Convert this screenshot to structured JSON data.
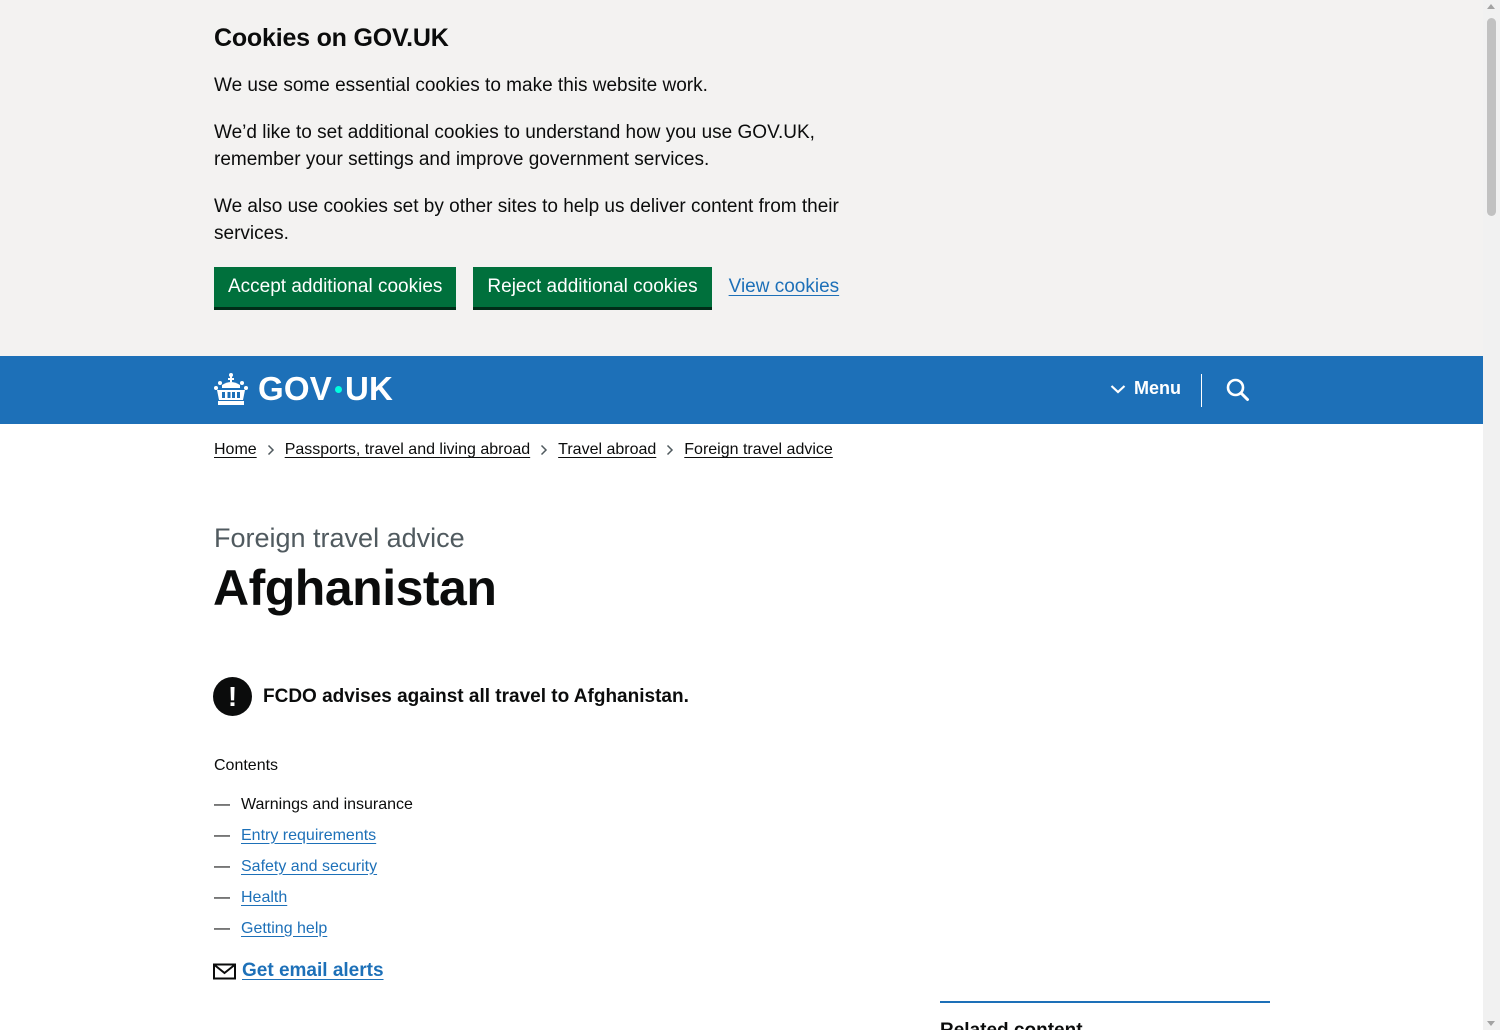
{
  "cookie_banner": {
    "title": "Cookies on GOV.UK",
    "paragraphs": [
      "We use some essential cookies to make this website work.",
      "We’d like to set additional cookies to understand how you use GOV.UK, remember your settings and improve government services.",
      "We also use cookies set by other sites to help us deliver content from their services."
    ],
    "accept_label": "Accept additional cookies",
    "reject_label": "Reject additional cookies",
    "view_label": "View cookies"
  },
  "header": {
    "logo_left": "GOV",
    "logo_right": "UK",
    "menu_label": "Menu",
    "icons": {
      "crown": "crown-icon",
      "menu": "chevron-down-icon",
      "search": "search-icon"
    },
    "colors": {
      "background": "#1d70b8",
      "logo_dot": "#00ffe0"
    }
  },
  "breadcrumbs": [
    "Home",
    "Passports, travel and living abroad",
    "Travel abroad",
    "Foreign travel advice"
  ],
  "page": {
    "caption": "Foreign travel advice",
    "title": "Afghanistan",
    "warning_text": "FCDO advises against all travel to Afghanistan.",
    "warning_icon_glyph": "!"
  },
  "contents": {
    "label": "Contents",
    "items": [
      {
        "label": "Warnings and insurance",
        "current": true
      },
      {
        "label": "Entry requirements",
        "current": false
      },
      {
        "label": "Safety and security",
        "current": false
      },
      {
        "label": "Health",
        "current": false
      },
      {
        "label": "Getting help",
        "current": false
      }
    ]
  },
  "email_alerts": {
    "label": "Get email alerts",
    "icon": "envelope-icon"
  },
  "related": {
    "title": "Related content"
  },
  "colors": {
    "link": "#1d70b8",
    "button_green": "#00703c",
    "banner_bg": "#f3f2f1"
  }
}
